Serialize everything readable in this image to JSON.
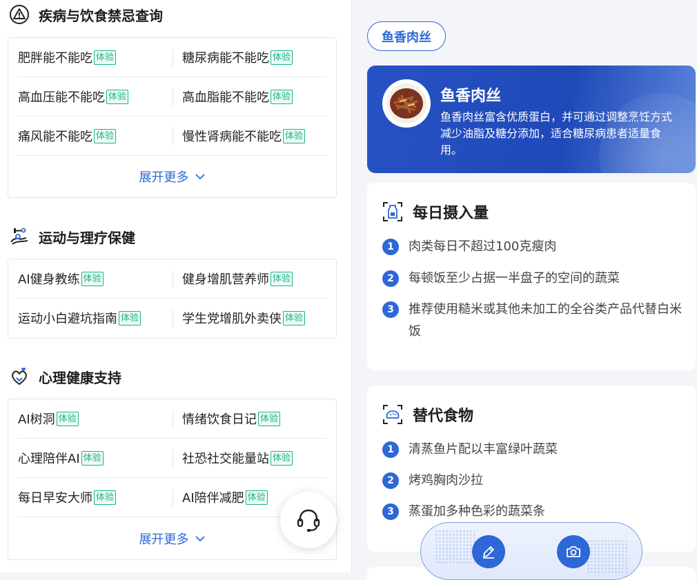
{
  "colors": {
    "accent": "#2d67d8",
    "tag": "#18b38a"
  },
  "left": {
    "sections": [
      {
        "title": "疾病与饮食禁忌查询",
        "icon": "warning-triangle-icon",
        "rows": [
          {
            "l": "肥胖能不能吃",
            "r": "糖尿病能不能吃"
          },
          {
            "l": "高血压能不能吃",
            "r": "高血脂能不能吃"
          },
          {
            "l": "痛风能不能吃",
            "r": "慢性肾病能不能吃"
          }
        ],
        "more": "展开更多"
      },
      {
        "title": "运动与理疗保健",
        "icon": "exercise-icon",
        "rows": [
          {
            "l": "AI健身教练",
            "r": "健身增肌营养师"
          },
          {
            "l": "运动小白避坑指南",
            "r": "学生党增肌外卖侠"
          }
        ]
      },
      {
        "title": "心理健康支持",
        "icon": "heart-hands-icon",
        "rows": [
          {
            "l": "AI树洞",
            "r": "情绪饮食日记"
          },
          {
            "l": "心理陪伴AI",
            "r": "社恐社交能量站"
          },
          {
            "l": "每日早安大师",
            "r": "AI陪伴减肥"
          }
        ],
        "more": "展开更多"
      }
    ],
    "tag": "体验"
  },
  "right": {
    "food_pill": "鱼香肉丝",
    "hero": {
      "title": "鱼香肉丝",
      "desc": "鱼香肉丝富含优质蛋白，并可通过调整烹饪方式减少油脂及糖分添加，适合糖尿病患者适量食用。"
    },
    "daily": {
      "title": "每日摄入量",
      "items": [
        "肉类每日不超过100克瘦肉",
        "每顿饭至少占据一半盘子的空间的蔬菜",
        "推荐使用糙米或其他未加工的全谷类产品代替白米饭"
      ]
    },
    "alternatives": {
      "title": "替代食物",
      "items": [
        "清蒸鱼片配以丰富绿叶蔬菜",
        "烤鸡胸肉沙拉",
        "蒸蛋加多种色彩的蔬菜条"
      ]
    },
    "nums": [
      "1",
      "2",
      "3"
    ]
  }
}
